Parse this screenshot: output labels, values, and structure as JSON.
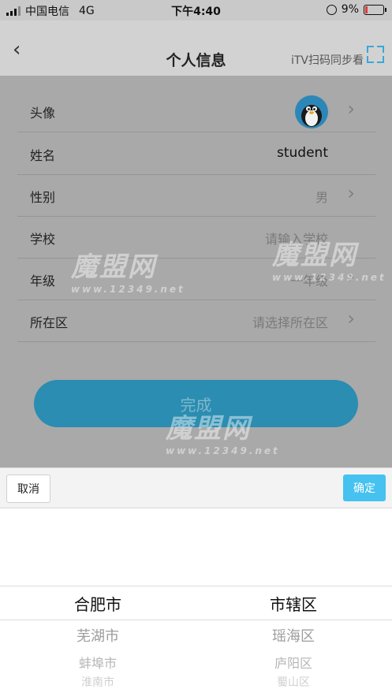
{
  "status_bar": {
    "carrier": "中国电信",
    "network": "4G",
    "time": "下午4:40",
    "battery": "9%"
  },
  "nav": {
    "title": "个人信息",
    "action": "iTV扫码同步看"
  },
  "form": {
    "avatar_label": "头像",
    "name_label": "姓名",
    "name_value": "student",
    "gender_label": "性别",
    "gender_value": "男",
    "school_label": "学校",
    "school_placeholder": "请输入学校",
    "grade_label": "年级",
    "grade_value": "一年级",
    "district_label": "所在区",
    "district_placeholder": "请选择所在区"
  },
  "done_label": "完成",
  "watermark": {
    "brand": "魔盟网",
    "url": "www.12349.net"
  },
  "picker": {
    "cancel_label": "取消",
    "confirm_label": "确定",
    "cities": [
      "合肥市",
      "芜湖市",
      "蚌埠市",
      "淮南市"
    ],
    "districts": [
      "市辖区",
      "瑶海区",
      "庐阳区",
      "蜀山区"
    ]
  },
  "colors": {
    "accent": "#2a8db1",
    "confirm": "#45c2ef",
    "battery_low": "#e03a3a"
  }
}
